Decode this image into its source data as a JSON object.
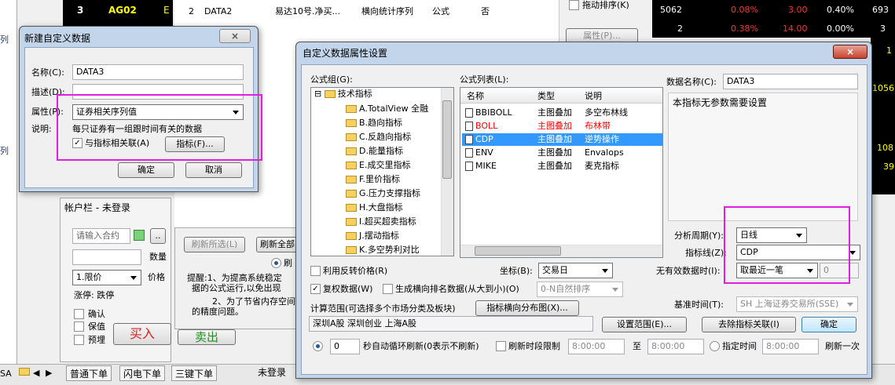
{
  "top_table": {
    "num": "3",
    "code": "AG02",
    "mark": "E",
    "rows": [
      {
        "n": "2",
        "name": "DATA2",
        "source": "易达10号.净买...",
        "type": "横向统计序列",
        "kind": "公式",
        "flag": "否"
      }
    ]
  },
  "sort_check": "拖动排序(K)",
  "attr_button": "属性(P)...",
  "quotes": [
    {
      "vol": "5062",
      "pct": "0.08%",
      "chg": "3.00",
      "pct2": "0.40%",
      "last": "693"
    },
    {
      "vol": "2",
      "pct": "0.38%",
      "chg": "14.00",
      "pct2": "0.00%",
      "last": "3"
    }
  ],
  "right_edge": [
    "1",
    "1056",
    "108",
    "39"
  ],
  "left_side": {
    "sidebar_chars": [
      "列",
      "列"
    ],
    "account_title": "帐户栏 - 未登录",
    "contract_placeholder": "请输入合约",
    "qty_label": "数量",
    "order_type": "1.限价",
    "price_label": "价格",
    "limit": "涨停: 跌停",
    "checks": [
      "确认",
      "保值",
      "预埋"
    ],
    "buy": "买入",
    "sell": "卖出",
    "tabs": [
      "普通下单",
      "闪电下单",
      "三键下单"
    ],
    "bottom_tab": "未登录",
    "sa": "SA"
  },
  "mid_behind": {
    "refresh_sel": "刷新所选(L)",
    "refresh_all": "刷新全部",
    "radio_text": "刷",
    "tip1": "提醒:1、为提高系统稳定",
    "tip2": "据的公式运行,以免出现",
    "tip3": "2、为了节省内存空间",
    "tip4": "的精度问题。"
  },
  "new_dialog": {
    "title": "新建自定义数据",
    "name_label": "名称(C):",
    "name_value": "DATA3",
    "desc_label": "描述(D):",
    "attr_label": "属性(P):",
    "attr_value": "证券相关序列值",
    "expl_label": "说明:",
    "expl_text": "每只证券有一组跟时间有关的数据",
    "link_check": "与指标相关联(A)",
    "indicator_btn": "指标(F)...",
    "ok": "确定",
    "cancel": "取消",
    "close": "×"
  },
  "prop_dialog": {
    "title": "自定义数据属性设置",
    "group_label": "公式组(G):",
    "root": "技术指标",
    "groups": [
      "A.TotalView 全融",
      "B.趋向指标",
      "C.反趋向指标",
      "D.能量指标",
      "E.成交里指标",
      "F.里价指标",
      "G.压力支撑指标",
      "H.大盘指标",
      "I.超买超卖指标",
      "J.摆动指标",
      "K.多空势利对比"
    ],
    "list_label": "公式列表(L):",
    "cols": [
      "名称",
      "类型",
      "说明"
    ],
    "formulas": [
      {
        "name": "BBIBOLL",
        "type": "主图叠加",
        "desc": "多空布林线"
      },
      {
        "name": "BOLL",
        "type": "主图叠加",
        "desc": "布林带"
      },
      {
        "name": "CDP",
        "type": "主图叠加",
        "desc": "逆势操作"
      },
      {
        "name": "ENV",
        "type": "主图叠加",
        "desc": "Envalops"
      },
      {
        "name": "MIKE",
        "type": "主图叠加",
        "desc": "麦克指标"
      }
    ],
    "dataname_label": "数据名称(C):",
    "dataname_value": "DATA3",
    "param_text": "本指标无参数需要设置",
    "period_label": "分析周期(Y):",
    "period_value": "日线",
    "line_label": "指标线(Z):",
    "line_value": "CDP",
    "invalid_label": "无有效数据时(I):",
    "invalid_value": "取最近一笔",
    "invalid_num": "0",
    "reverse_check": "利用反转价格(R)",
    "coord_label": "坐标(B):",
    "coord_value": "交易日",
    "restore_check": "复权数据(W)",
    "rank_check": "生成横向排名数据(从大到小)(O)",
    "rank_combo": "0-N自然排序",
    "basetime_label": "基准时间(T):",
    "basetime_value": "SH 上海证券交易所(SSE)",
    "range_label": "计算范围(可选择多个市场分类及板块)",
    "dist_btn": "指标横向分布图(X)...",
    "range_value": "深圳A股  深圳创业  上海A股",
    "set_range_btn": "设置范围(E)...",
    "remove_link_btn": "去除指标关联(I)",
    "ok": "确定",
    "refresh_value": "0",
    "refresh_text": "秒自动循环刷新(0表示不刷新)",
    "limit_check": "刷新时段限制",
    "time1": "8:00:00",
    "to": "至",
    "time2": "8:00:00",
    "fixed_radio": "指定时间",
    "time3": "8:00:00",
    "refresh_once": "刷新一次",
    "close": "×"
  },
  "colors": {
    "accent": "#3399ff",
    "red": "#ff0000",
    "magenta": "#e020e0"
  }
}
